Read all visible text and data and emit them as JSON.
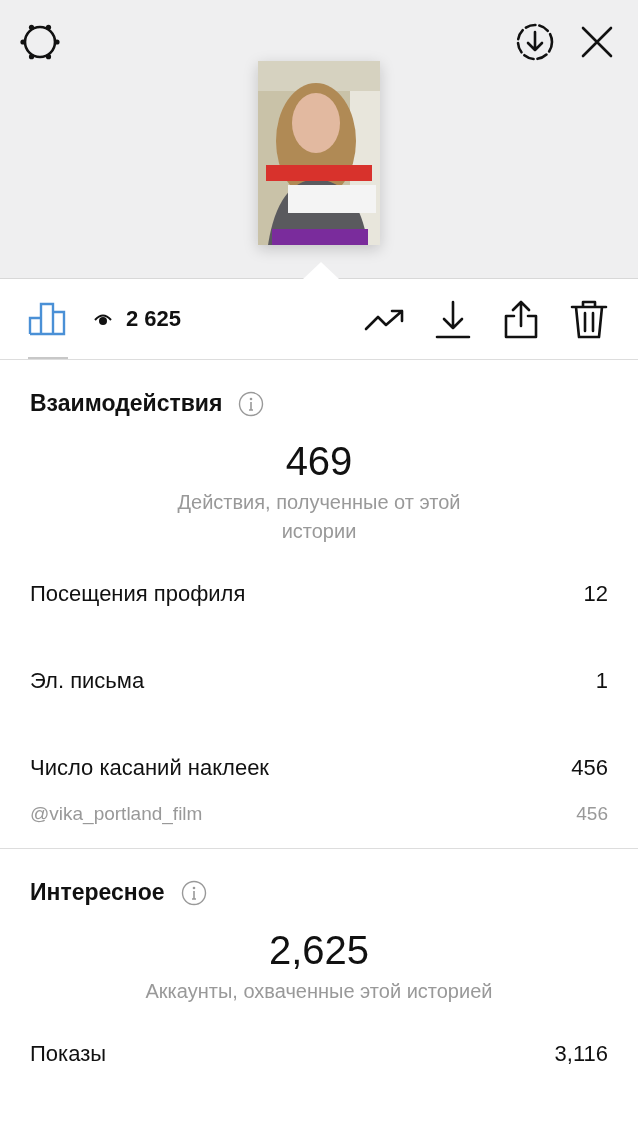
{
  "toolbar": {
    "insights_tab": {
      "selected": true
    },
    "views": "2 625"
  },
  "sections": [
    {
      "title": "Взаимодействия",
      "total": "469",
      "caption": "Действия, полученные от этой истории",
      "rows": [
        {
          "kind": "main",
          "label": "Посещения профиля",
          "value": "12"
        },
        {
          "kind": "main",
          "label": "Эл. письма",
          "value": "1"
        },
        {
          "kind": "main",
          "label": "Число касаний наклеек",
          "value": "456"
        },
        {
          "kind": "sub",
          "label": "@vika_portland_film",
          "value": "456"
        }
      ]
    },
    {
      "title": "Интересное",
      "total": "2,625",
      "caption": "Аккаунты, охваченные этой историей",
      "rows": [
        {
          "kind": "main",
          "label": "Показы",
          "value": "3,116"
        }
      ]
    }
  ]
}
